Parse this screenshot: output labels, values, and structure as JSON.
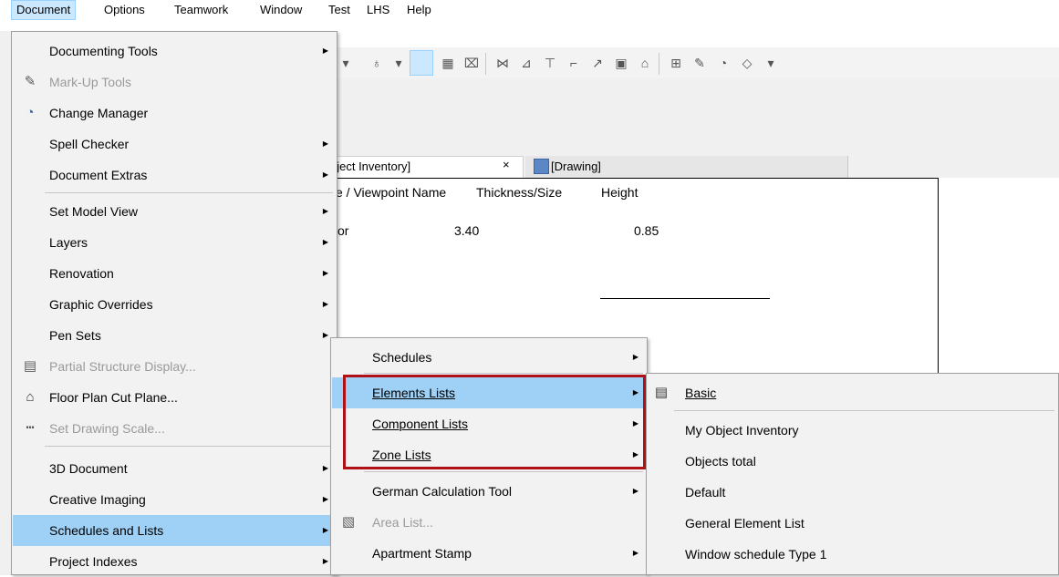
{
  "menubar": {
    "items": [
      "Document",
      "Options",
      "Teamwork",
      "Window",
      "Test",
      "LHS",
      "Help"
    ]
  },
  "tabs": {
    "tab1_label": "bject Inventory]",
    "tab1_close": "×",
    "tab2_label": "[Drawing]"
  },
  "sheet": {
    "header_name": "e / Viewpoint Name",
    "header_thickness": "Thickness/Size",
    "header_height": "Height",
    "row_name": "or",
    "row_thickness": "3.40",
    "row_height": "0.85"
  },
  "document_menu": {
    "items": [
      {
        "label": "Documenting Tools",
        "icon": "",
        "disabled": false,
        "submenu": true
      },
      {
        "label": "Mark-Up Tools",
        "icon": "markup-icon",
        "disabled": true,
        "submenu": false
      },
      {
        "label": "Change Manager",
        "icon": "change-manager-icon",
        "disabled": false,
        "submenu": false
      },
      {
        "label": "Spell Checker",
        "icon": "",
        "disabled": false,
        "submenu": true
      },
      {
        "label": "Document Extras",
        "icon": "",
        "disabled": false,
        "submenu": true
      },
      {
        "label": "Set Model View",
        "icon": "",
        "disabled": false,
        "submenu": true
      },
      {
        "label": "Layers",
        "icon": "",
        "disabled": false,
        "submenu": true
      },
      {
        "label": "Renovation",
        "icon": "",
        "disabled": false,
        "submenu": true
      },
      {
        "label": "Graphic Overrides",
        "icon": "",
        "disabled": false,
        "submenu": true
      },
      {
        "label": "Pen Sets",
        "icon": "",
        "disabled": false,
        "submenu": true
      },
      {
        "label": "Partial Structure Display...",
        "icon": "partial-structure-icon",
        "disabled": true,
        "submenu": false
      },
      {
        "label": "Floor Plan Cut Plane...",
        "icon": "floor-plan-cut-plane-icon",
        "disabled": false,
        "submenu": false
      },
      {
        "label": "Set Drawing Scale...",
        "icon": "drawing-scale-icon",
        "disabled": true,
        "submenu": false
      },
      {
        "label": "3D Document",
        "icon": "",
        "disabled": false,
        "submenu": true
      },
      {
        "label": "Creative Imaging",
        "icon": "",
        "disabled": false,
        "submenu": true
      },
      {
        "label": "Schedules and Lists",
        "icon": "",
        "disabled": false,
        "submenu": true,
        "active": true
      },
      {
        "label": "Project Indexes",
        "icon": "",
        "disabled": false,
        "submenu": true
      }
    ]
  },
  "schedules_menu": {
    "items": [
      {
        "label": "Schedules",
        "submenu": true
      },
      {
        "label": "Elements Lists",
        "submenu": true,
        "active": true
      },
      {
        "label": "Component Lists",
        "submenu": true
      },
      {
        "label": "Zone Lists",
        "submenu": true
      },
      {
        "label": "German Calculation Tool",
        "submenu": true
      },
      {
        "label": "Area List...",
        "submenu": false,
        "disabled": true,
        "icon": "area-list-icon"
      },
      {
        "label": "Apartment Stamp",
        "submenu": true
      }
    ]
  },
  "elements_lists_menu": {
    "items": [
      {
        "label": "Basic",
        "icon": "list-scheme-icon"
      },
      {
        "label": "My Object Inventory"
      },
      {
        "label": "Objects total"
      },
      {
        "label": "Default"
      },
      {
        "label": "General Element List"
      },
      {
        "label": "Window schedule Type 1"
      }
    ]
  },
  "colors": {
    "highlight": "#9fd0f5",
    "annotation_box": "#b01116",
    "menu_bg": "#f2f2f2"
  }
}
